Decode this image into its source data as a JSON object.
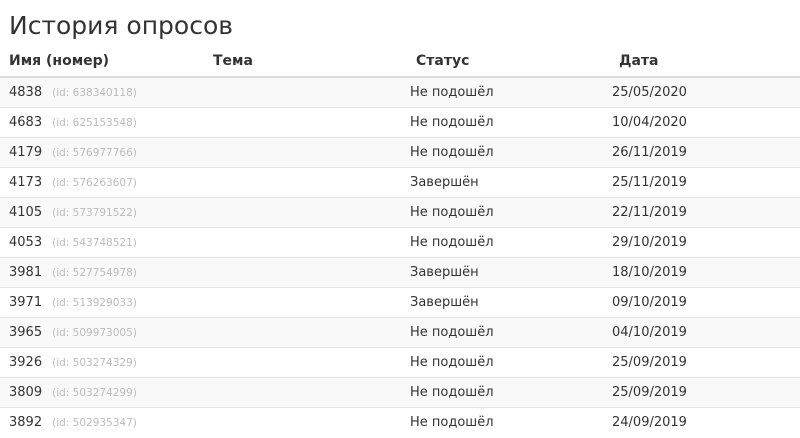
{
  "page_title": "История опросов",
  "columns": {
    "name": "Имя (номер)",
    "topic": "Тема",
    "status": "Статус",
    "date": "Дата"
  },
  "rows": [
    {
      "number": "4838",
      "id": "(id: 638340118)",
      "topic": "",
      "status": "Не подошёл",
      "date": "25/05/2020"
    },
    {
      "number": "4683",
      "id": "(id: 625153548)",
      "topic": "",
      "status": "Не подошёл",
      "date": "10/04/2020"
    },
    {
      "number": "4179",
      "id": "(id: 576977766)",
      "topic": "",
      "status": "Не подошёл",
      "date": "26/11/2019"
    },
    {
      "number": "4173",
      "id": "(id: 576263607)",
      "topic": "",
      "status": "Завершён",
      "date": "25/11/2019"
    },
    {
      "number": "4105",
      "id": "(id: 573791522)",
      "topic": "",
      "status": "Не подошёл",
      "date": "22/11/2019"
    },
    {
      "number": "4053",
      "id": "(id: 543748521)",
      "topic": "",
      "status": "Не подошёл",
      "date": "29/10/2019"
    },
    {
      "number": "3981",
      "id": "(id: 527754978)",
      "topic": "",
      "status": "Завершён",
      "date": "18/10/2019"
    },
    {
      "number": "3971",
      "id": "(id: 513929033)",
      "topic": "",
      "status": "Завершён",
      "date": "09/10/2019"
    },
    {
      "number": "3965",
      "id": "(id: 509973005)",
      "topic": "",
      "status": "Не подошёл",
      "date": "04/10/2019"
    },
    {
      "number": "3926",
      "id": "(id: 503274329)",
      "topic": "",
      "status": "Не подошёл",
      "date": "25/09/2019"
    },
    {
      "number": "3809",
      "id": "(id: 503274299)",
      "topic": "",
      "status": "Не подошёл",
      "date": "25/09/2019"
    },
    {
      "number": "3892",
      "id": "(id: 502935347)",
      "topic": "",
      "status": "Не подошёл",
      "date": "24/09/2019"
    }
  ]
}
